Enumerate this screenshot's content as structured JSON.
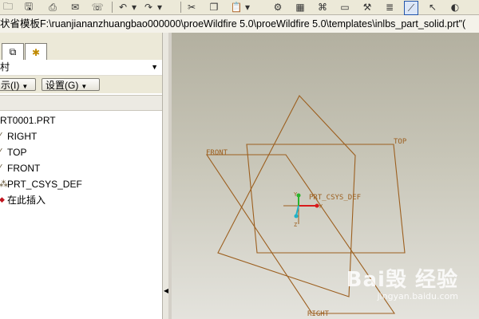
{
  "toolbar": {
    "icons": [
      "folder-icon",
      "save-icon",
      "print-icon",
      "send-icon",
      "undo-icon",
      "undo-dropdown-icon",
      "redo-icon",
      "redo-dropdown-icon",
      "cut-icon",
      "copy-icon",
      "paste-icon",
      "paste-dropdown-icon",
      "regenerate-icon",
      "window-icon",
      "sketch-icon",
      "select-filter-icon",
      "globe-icon"
    ]
  },
  "path_bar": {
    "text": "状省模板F:\\ruanjiananzhuangbao000000\\proeWildfire 5.0\\proeWildfire 5.0\\templates\\inlbs_part_solid.prt\"("
  },
  "left_panel": {
    "tabs": [
      {
        "icon": "layers-icon",
        "glyph": "⧉"
      },
      {
        "icon": "favorites-icon",
        "glyph": "✱"
      }
    ],
    "show_dropdown": {
      "label": "村",
      "arrow": "▼"
    },
    "menus": {
      "show_label": "示(I)",
      "settings_label": "设置(G)",
      "arrow": "▼"
    },
    "model_tree": [
      {
        "label": "RT0001.PRT",
        "icon": "part-icon",
        "glyph": ""
      },
      {
        "label": "RIGHT",
        "icon": "datum-plane-icon",
        "glyph": "⁄"
      },
      {
        "label": "TOP",
        "icon": "datum-plane-icon",
        "glyph": "⁄"
      },
      {
        "label": "FRONT",
        "icon": "datum-plane-icon",
        "glyph": "⁄"
      },
      {
        "label": "PRT_CSYS_DEF",
        "icon": "csys-icon",
        "glyph": "⁂"
      },
      {
        "label": "在此插入",
        "icon": "insert-here-icon",
        "glyph": "◆"
      }
    ]
  },
  "scrollbar": {
    "arrow": "◀"
  },
  "viewport": {
    "labels": {
      "front": "FRONT",
      "top": "TOP",
      "right": "RIGHT",
      "csys": "PRT_CSYS_DEF",
      "axis_x": "X",
      "axis_y": "Y",
      "axis_z": "Z"
    },
    "plane_color": "#9c5f1f",
    "watermark": {
      "logo": "Bai毁 经验",
      "url": "jingyan.baidu.com"
    }
  }
}
